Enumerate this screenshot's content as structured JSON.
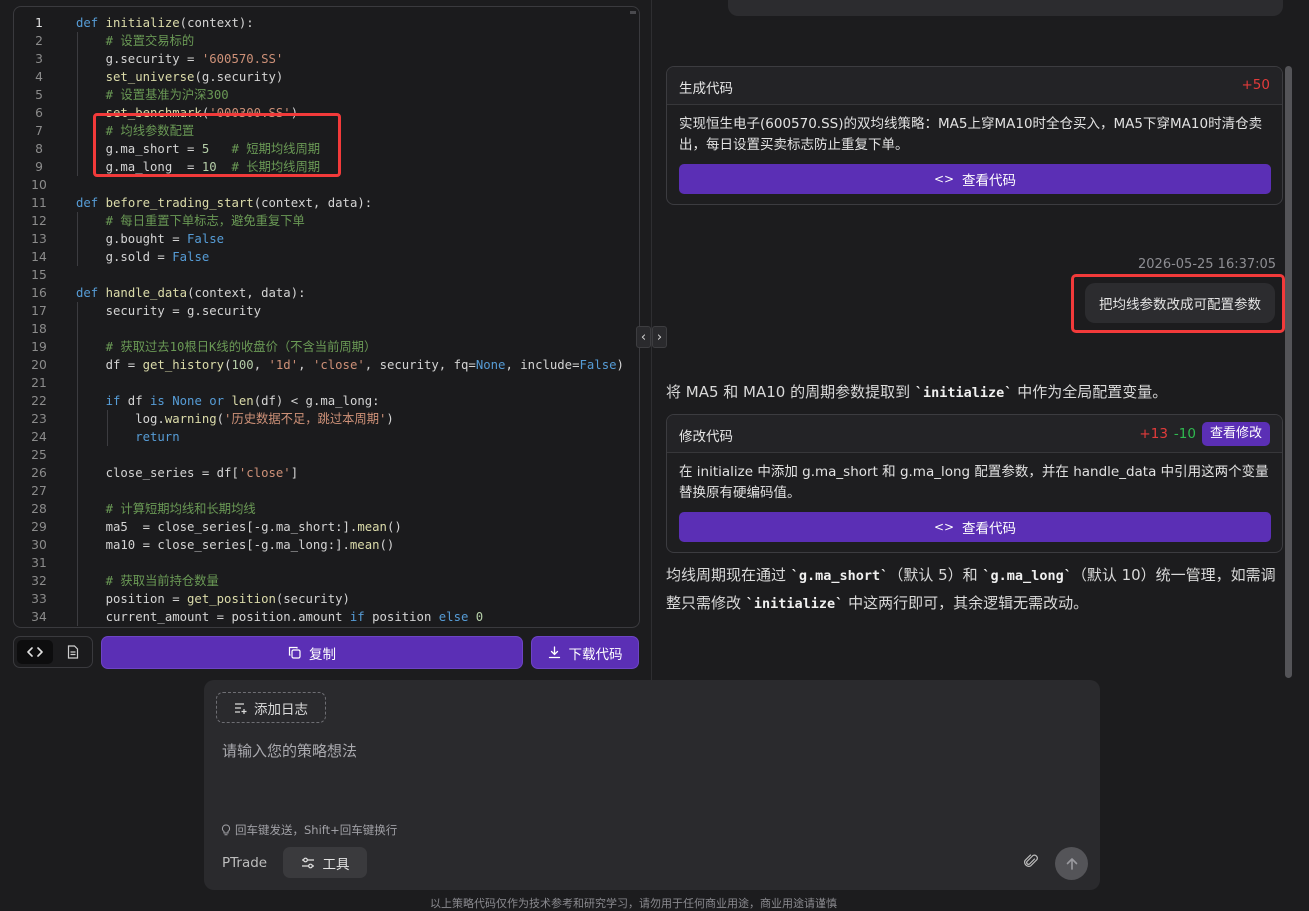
{
  "editor": {
    "lines": [
      {
        "n": "1",
        "indent": 0,
        "html": "<span class='kw'>def</span> <span class='fn'>initialize</span>(context):"
      },
      {
        "n": "2",
        "indent": 1,
        "html": "<span class='com'># 设置交易标的</span>"
      },
      {
        "n": "3",
        "indent": 1,
        "html": "g.security = <span class='str'>'600570.SS'</span>"
      },
      {
        "n": "4",
        "indent": 1,
        "html": "<span class='fn'>set_universe</span>(g.security)"
      },
      {
        "n": "5",
        "indent": 1,
        "html": "<span class='com'># 设置基准为沪深300</span>"
      },
      {
        "n": "6",
        "indent": 1,
        "html": "<span class='fn'>set_benchmark</span>(<span class='str'>'000300.SS'</span>)"
      },
      {
        "n": "7",
        "indent": 1,
        "html": "<span class='com'># 均线参数配置</span>"
      },
      {
        "n": "8",
        "indent": 1,
        "html": "g.ma_short = <span class='num'>5</span>   <span class='com'># 短期均线周期</span>"
      },
      {
        "n": "9",
        "indent": 1,
        "html": "g.ma_long  = <span class='num'>10</span>  <span class='com'># 长期均线周期</span>"
      },
      {
        "n": "10",
        "indent": 0,
        "html": ""
      },
      {
        "n": "11",
        "indent": 0,
        "html": "<span class='kw'>def</span> <span class='fn'>before_trading_start</span>(context, data):"
      },
      {
        "n": "12",
        "indent": 1,
        "html": "<span class='com'># 每日重置下单标志，避免重复下单</span>"
      },
      {
        "n": "13",
        "indent": 1,
        "html": "g.bought = <span class='kw'>False</span>"
      },
      {
        "n": "14",
        "indent": 1,
        "html": "g.sold = <span class='kw'>False</span>"
      },
      {
        "n": "15",
        "indent": 0,
        "html": ""
      },
      {
        "n": "16",
        "indent": 0,
        "html": "<span class='kw'>def</span> <span class='fn'>handle_data</span>(context, data):"
      },
      {
        "n": "17",
        "indent": 1,
        "html": "security = g.security"
      },
      {
        "n": "18",
        "indent": 1,
        "html": ""
      },
      {
        "n": "19",
        "indent": 1,
        "html": "<span class='com'># 获取过去10根日K线的收盘价（不含当前周期）</span>"
      },
      {
        "n": "20",
        "indent": 1,
        "html": "df = <span class='fn'>get_history</span>(<span class='num'>100</span>, <span class='str'>'1d'</span>, <span class='str'>'close'</span>, security, fq=<span class='kw'>None</span>, include=<span class='kw'>False</span>)"
      },
      {
        "n": "21",
        "indent": 1,
        "html": ""
      },
      {
        "n": "22",
        "indent": 1,
        "html": "<span class='kw'>if</span> df <span class='kw'>is</span> <span class='kw'>None</span> <span class='kw'>or</span> <span class='fn'>len</span>(df) &lt; g.ma_long:"
      },
      {
        "n": "23",
        "indent": 2,
        "html": "log.<span class='fn'>warning</span>(<span class='str'>'历史数据不足，跳过本周期'</span>)"
      },
      {
        "n": "24",
        "indent": 2,
        "html": "<span class='kw'>return</span>"
      },
      {
        "n": "25",
        "indent": 1,
        "html": ""
      },
      {
        "n": "26",
        "indent": 1,
        "html": "close_series = df[<span class='str'>'close'</span>]"
      },
      {
        "n": "27",
        "indent": 1,
        "html": ""
      },
      {
        "n": "28",
        "indent": 1,
        "html": "<span class='com'># 计算短期均线和长期均线</span>"
      },
      {
        "n": "29",
        "indent": 1,
        "html": "ma5  = close_series[-g.ma_short:].<span class='fn'>mean</span>()"
      },
      {
        "n": "30",
        "indent": 1,
        "html": "ma10 = close_series[-g.ma_long:].<span class='fn'>mean</span>()"
      },
      {
        "n": "31",
        "indent": 1,
        "html": ""
      },
      {
        "n": "32",
        "indent": 1,
        "html": "<span class='com'># 获取当前持仓数量</span>"
      },
      {
        "n": "33",
        "indent": 1,
        "html": "position = <span class='fn'>get_position</span>(security)"
      },
      {
        "n": "34",
        "indent": 1,
        "html": "current_amount = position.amount <span class='kw'>if</span> position <span class='kw'>else</span> <span class='num'>0</span>"
      }
    ]
  },
  "toolbar": {
    "copy_label": "复制",
    "download_label": "下载代码"
  },
  "chat": {
    "card1": {
      "title": "生成代码",
      "added": "+50",
      "body": "实现恒生电子(600570.SS)的双均线策略：MA5上穿MA10时全仓买入，MA5下穿MA10时清仓卖出，每日设置买卖标志防止重复下单。",
      "button": "查看代码"
    },
    "timestamp": "2026-05-25 16:37:05",
    "user_message": "把均线参数改成可配置参数",
    "reply1_pre": "将 MA5 和 MA10 的周期参数提取到 ",
    "reply1_code": "`initialize`",
    "reply1_post": " 中作为全局配置变量。",
    "card2": {
      "title": "修改代码",
      "added": "+13",
      "removed": "-10",
      "view_diff": "查看修改",
      "body": "在 initialize 中添加 g.ma_short 和 g.ma_long 配置参数，并在 handle_data 中引用这两个变量替换原有硬编码值。",
      "button": "查看代码"
    },
    "reply2_a": "均线周期现在通过 ",
    "reply2_code1": "`g.ma_short`",
    "reply2_b": "（默认 5）和 ",
    "reply2_code2": "`g.ma_long`",
    "reply2_c": "（默认 10）统一管理，如需调整只需修改 ",
    "reply2_code3": "`initialize`",
    "reply2_d": " 中这两行即可，其余逻辑无需改动。"
  },
  "input": {
    "add_log": "添加日志",
    "placeholder": "请输入您的策略想法",
    "hint": "回车键发送，Shift+回车键换行",
    "platform": "PTrade",
    "tools": "工具"
  },
  "footer_note": "以上策略代码仅作为技术参考和研究学习，请勿用于任何商业用途，商业用途请谨慎"
}
